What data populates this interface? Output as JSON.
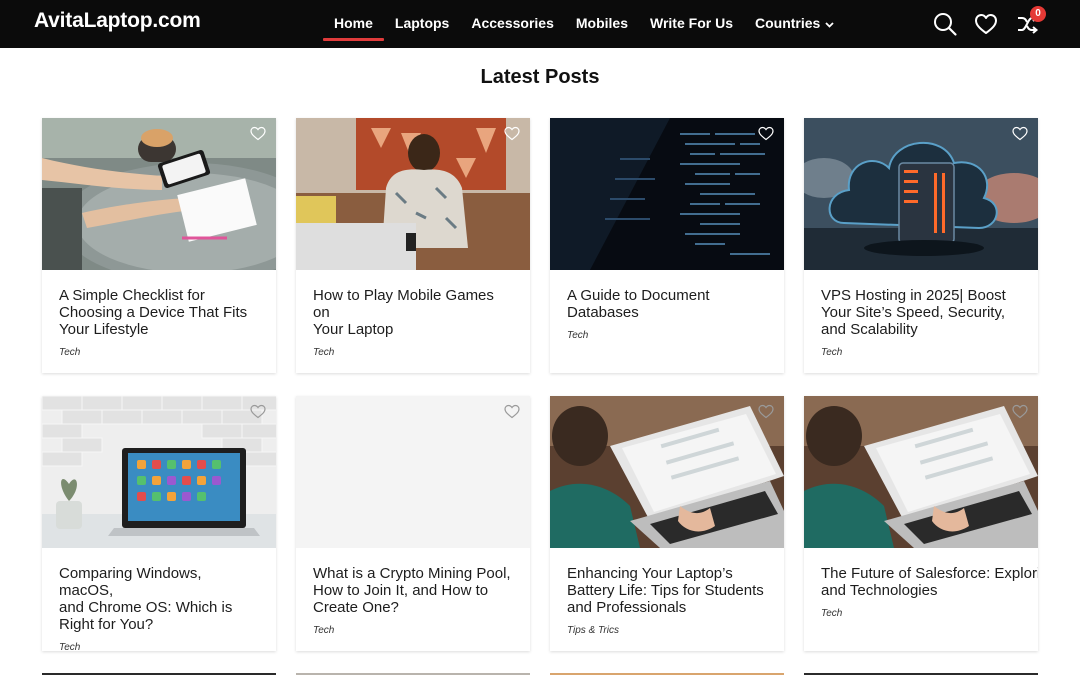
{
  "header": {
    "logo": "AvitaLaptop.com",
    "nav": [
      {
        "label": "Home",
        "active": true
      },
      {
        "label": "Laptops",
        "active": false
      },
      {
        "label": "Accessories",
        "active": false
      },
      {
        "label": "Mobiles",
        "active": false
      },
      {
        "label": "Write For Us",
        "active": false
      },
      {
        "label": "Countries",
        "active": false,
        "has_dropdown": true
      }
    ],
    "icons": [
      "search-icon",
      "heart-icon",
      "compare-icon"
    ],
    "compare_count": "0",
    "accent": "#e03b3b"
  },
  "section": {
    "title": "Latest Posts"
  },
  "posts": [
    {
      "title": "A Simple Checklist for\nChoosing a Device That Fits\nYour Lifestyle",
      "category": "Tech",
      "image": "hands-phone-notebook"
    },
    {
      "title": "How to Play Mobile Games on\nYour Laptop",
      "category": "Tech",
      "image": "man-laptop-phone"
    },
    {
      "title": "A Guide to Document\nDatabases",
      "category": "Tech",
      "image": "code-screen"
    },
    {
      "title": "VPS Hosting in 2025| Boost\nYour Site’s Speed, Security,\nand Scalability",
      "category": "Tech",
      "image": "cloud-server"
    },
    {
      "title": "Comparing Windows, macOS,\nand Chrome OS: Which is\nRight for You?",
      "category": "Tech",
      "image": "laptop-brick-wall"
    },
    {
      "title": "What is a Crypto Mining Pool,\nHow to Join It, and How to\nCreate One?",
      "category": "Tech",
      "image": "blank"
    },
    {
      "title": "Enhancing Your Laptop’s\nBattery Life: Tips for Students\nand Professionals",
      "category": "Tips & Trics",
      "image": "laptop-typing"
    },
    {
      "title": "The Future of Salesforce: Explorin\nand Technologies",
      "category": "Tech",
      "image": "laptop-typing"
    }
  ]
}
